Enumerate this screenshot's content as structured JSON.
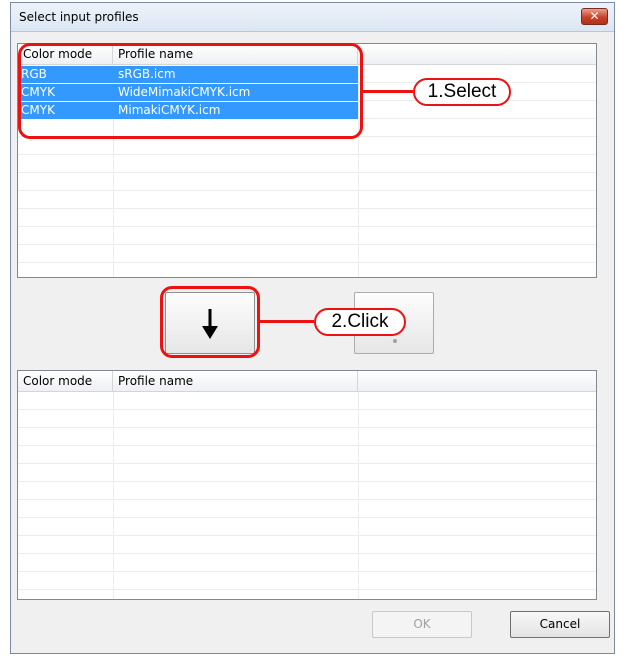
{
  "window": {
    "title": "Select input profiles",
    "close_glyph": "✕"
  },
  "top_list": {
    "columns": [
      "Color mode",
      "Profile name",
      ""
    ],
    "rows": [
      {
        "mode": "RGB",
        "name": "sRGB.icm",
        "selected": true
      },
      {
        "mode": "CMYK",
        "name": "WideMimakiCMYK.icm",
        "selected": true
      },
      {
        "mode": "CMYK",
        "name": "MimakiCMYK.icm",
        "selected": true
      }
    ]
  },
  "bottom_list": {
    "columns": [
      "Color mode",
      "Profile name",
      ""
    ],
    "rows": []
  },
  "buttons": {
    "ok": "OK",
    "cancel": "Cancel",
    "move_down_icon": "arrow-down-icon",
    "move_up_icon": "arrow-up-icon"
  },
  "callouts": {
    "step1": "1.Select",
    "step2": "2.Click"
  },
  "colors": {
    "selection": "#3399ff",
    "callout": "#ee1111"
  }
}
